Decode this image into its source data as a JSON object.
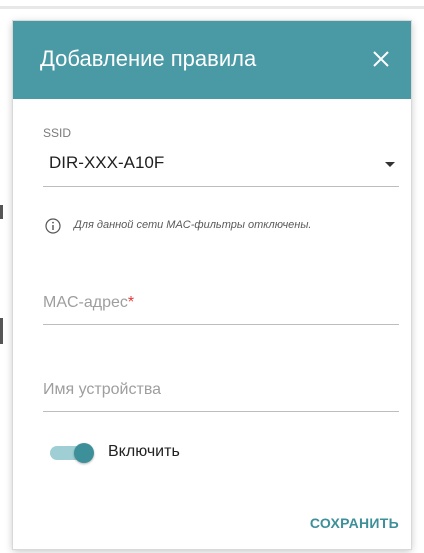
{
  "dialog": {
    "title": "Добавление правила",
    "close_icon": "close-icon",
    "header_color": "#4a9aa6",
    "accent_color": "#3d8f99"
  },
  "ssid": {
    "label": "SSID",
    "value": "DIR-XXX-A10F",
    "caret_icon": "caret-down-icon"
  },
  "info": {
    "icon": "info-icon",
    "text": "Для данной сети MAC-фильтры отключены."
  },
  "mac_field": {
    "placeholder": "MAC-адрес",
    "required_mark": "*"
  },
  "device_field": {
    "placeholder": "Имя устройства"
  },
  "enable_toggle": {
    "label": "Включить",
    "on": true
  },
  "actions": {
    "save_label": "СОХРАНИТЬ"
  }
}
